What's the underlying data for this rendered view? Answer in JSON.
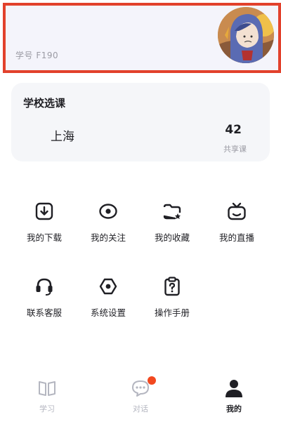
{
  "header": {
    "student_id": "学号 F190",
    "highlight_color": "#e2412c",
    "avatar_icon": "avatar-illustration"
  },
  "course": {
    "title": "学校选课",
    "city": "上海",
    "count": "42",
    "count_label": "共享课"
  },
  "menu": {
    "items": [
      {
        "label": "我的下载",
        "icon": "download-icon"
      },
      {
        "label": "我的关注",
        "icon": "eye-icon"
      },
      {
        "label": "我的收藏",
        "icon": "folder-star-icon"
      },
      {
        "label": "我的直播",
        "icon": "tv-icon"
      },
      {
        "label": "联系客服",
        "icon": "headset-icon"
      },
      {
        "label": "系统设置",
        "icon": "hexagon-settings-icon"
      },
      {
        "label": "操作手册",
        "icon": "clipboard-question-icon"
      }
    ]
  },
  "tabbar": {
    "tabs": [
      {
        "label": "学习",
        "icon": "book-icon",
        "active": false
      },
      {
        "label": "对话",
        "icon": "chat-bubble-icon",
        "active": false,
        "badge": true
      },
      {
        "label": "我的",
        "icon": "user-icon",
        "active": true
      }
    ],
    "badge_color": "#f2481f"
  }
}
